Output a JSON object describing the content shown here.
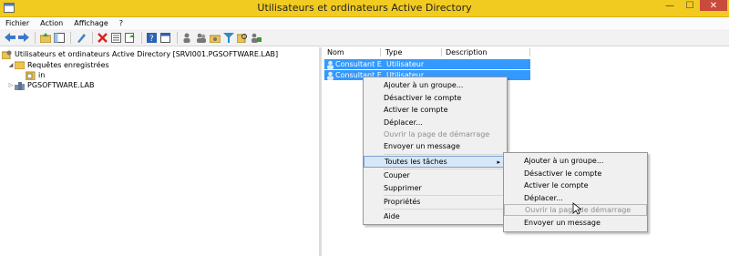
{
  "window": {
    "title": "Utilisateurs et ordinateurs Active Directory",
    "minimize_glyph": "—",
    "maximize_glyph": "☐",
    "close_glyph": "✕",
    "accent_color": "#f2cb21"
  },
  "menubar": {
    "items": [
      "Fichier",
      "Action",
      "Affichage",
      "?"
    ]
  },
  "toolbar": {
    "icons": [
      "back-arrow-icon",
      "forward-arrow-icon",
      "up-folder-icon",
      "show-tree-icon",
      "snap-in-icon",
      "delete-icon",
      "properties-icon",
      "export-icon",
      "help-icon",
      "console-icon",
      "add-user-icon",
      "add-group-icon",
      "add-ou-icon",
      "filter-icon",
      "find-icon",
      "add-to-group-icon"
    ]
  },
  "tree": {
    "root_label": "Utilisateurs et ordinateurs Active Directory [SRVI001.PGSOFTWARE.LAB]",
    "saved_queries_label": "Requêtes enregistrées",
    "saved_query_child": "in",
    "domain_label": "PGSOFTWARE.LAB"
  },
  "list": {
    "columns": [
      "Nom",
      "Type",
      "Description"
    ],
    "rows": [
      {
        "name": "Consultant E...",
        "type": "Utilisateur"
      },
      {
        "name": "Consultant E...",
        "type": "Utilisateur"
      }
    ]
  },
  "context_menu": {
    "items": [
      {
        "label": "Ajouter à un groupe...",
        "disabled": false
      },
      {
        "label": "Désactiver le compte",
        "disabled": false
      },
      {
        "label": "Activer le compte",
        "disabled": false
      },
      {
        "label": "Déplacer...",
        "disabled": false
      },
      {
        "label": "Ouvrir la page de démarrage",
        "disabled": true
      },
      {
        "label": "Envoyer un message",
        "disabled": false
      },
      {
        "label": "Toutes les tâches",
        "disabled": false,
        "submenu": true
      },
      {
        "label": "Couper",
        "disabled": false
      },
      {
        "label": "Supprimer",
        "disabled": false
      },
      {
        "label": "Propriétés",
        "disabled": false
      },
      {
        "label": "Aide",
        "disabled": false
      }
    ],
    "submenu_arrow": "▸"
  },
  "submenu": {
    "items": [
      {
        "label": "Ajouter à un groupe...",
        "disabled": false
      },
      {
        "label": "Désactiver le compte",
        "disabled": false
      },
      {
        "label": "Activer le compte",
        "disabled": false
      },
      {
        "label": "Déplacer...",
        "disabled": false
      },
      {
        "label": "Ouvrir la page de démarrage",
        "disabled": true
      },
      {
        "label": "Envoyer un message",
        "disabled": false
      }
    ]
  },
  "colors": {
    "selection": "#3399ff",
    "titlebar": "#f2cb21",
    "close_button": "#c94b3b",
    "menu_background": "#f0f0f0",
    "menu_hot": "#d7e7f7"
  }
}
